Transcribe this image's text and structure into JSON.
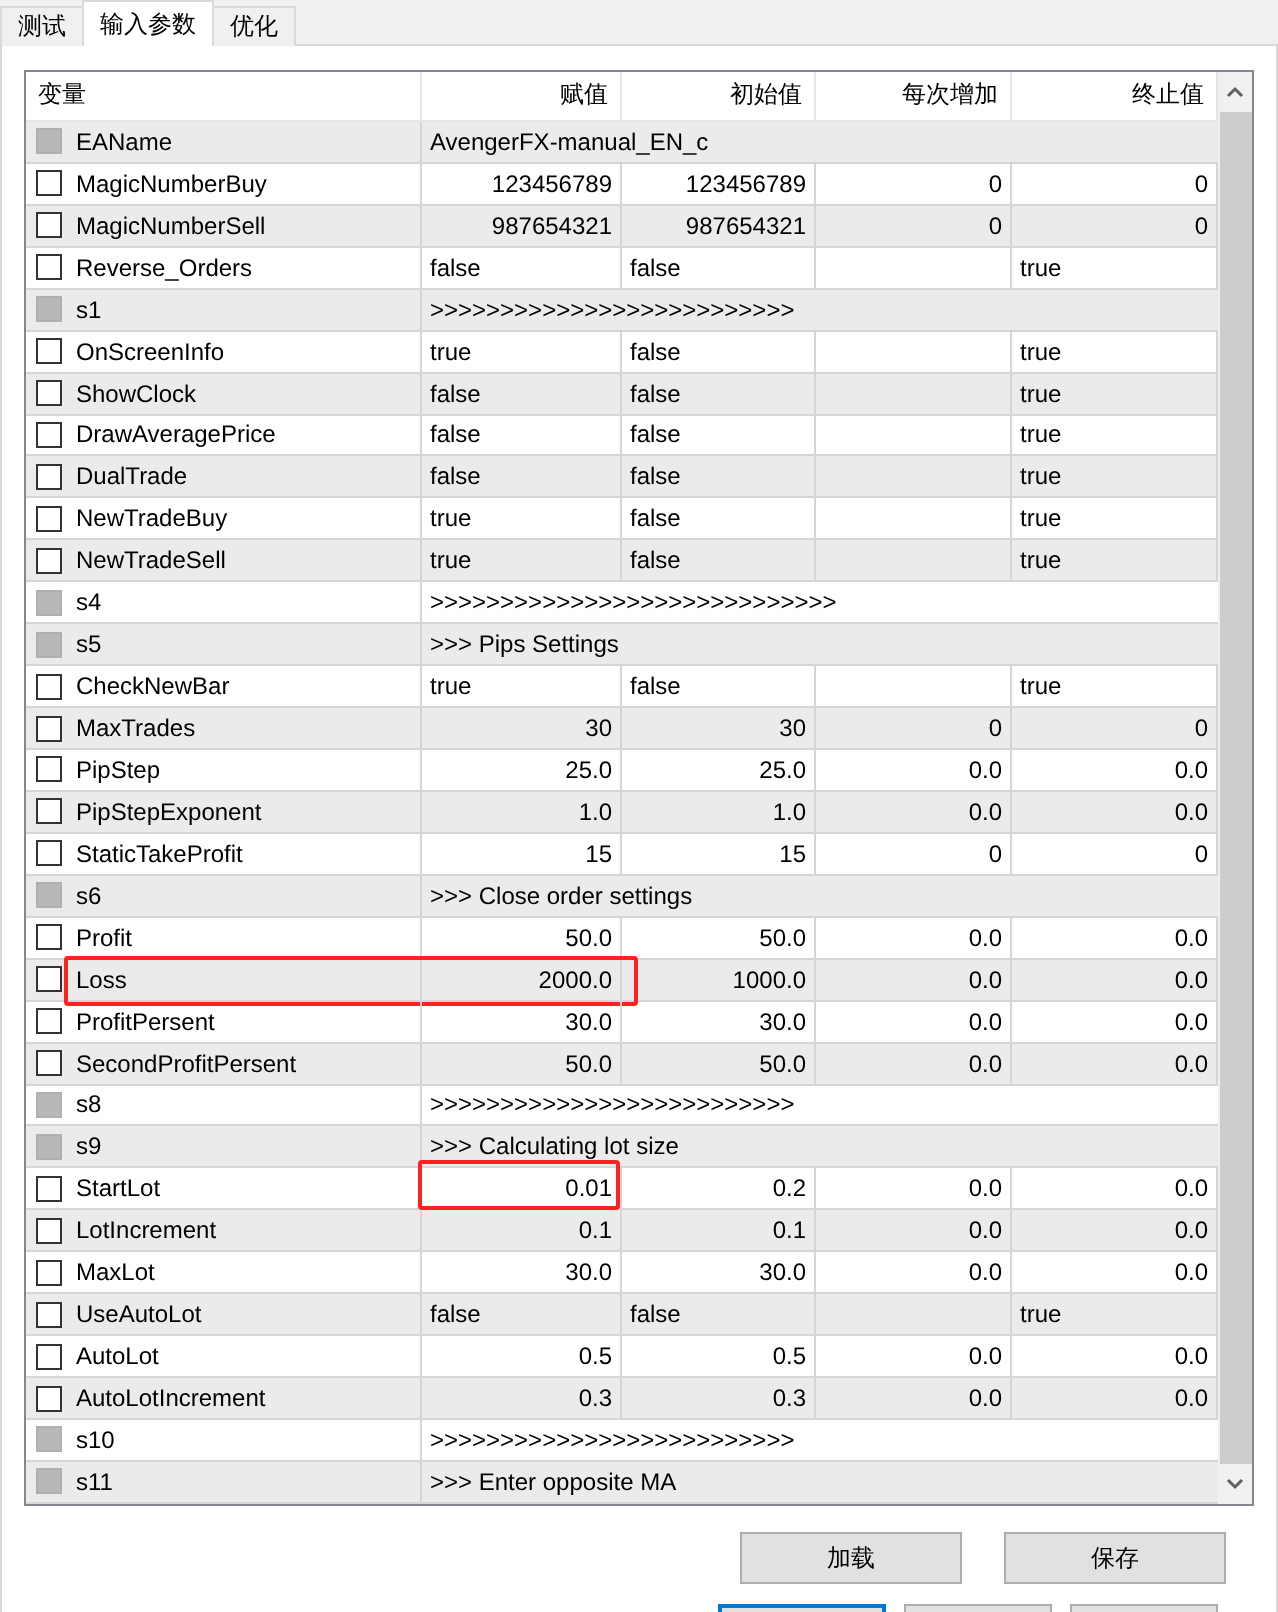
{
  "tabs": [
    {
      "label": "测试",
      "selected": false
    },
    {
      "label": "输入参数",
      "selected": true
    },
    {
      "label": "优化",
      "selected": false
    }
  ],
  "table": {
    "columns": [
      "变量",
      "赋值",
      "初始值",
      "每次增加",
      "终止值"
    ],
    "rows": [
      {
        "kind": "span",
        "name": "EAName",
        "checked": false,
        "disabled": true,
        "value": "AvengerFX-manual_EN_c"
      },
      {
        "kind": "number",
        "name": "MagicNumberBuy",
        "checked": false,
        "disabled": false,
        "value": "123456789",
        "start": "123456789",
        "step": "0",
        "stop": "0"
      },
      {
        "kind": "number",
        "name": "MagicNumberSell",
        "checked": false,
        "disabled": false,
        "value": "987654321",
        "start": "987654321",
        "step": "0",
        "stop": "0"
      },
      {
        "kind": "bool",
        "name": "Reverse_Orders",
        "checked": false,
        "disabled": false,
        "value": "false",
        "start": "false",
        "stop": "true"
      },
      {
        "kind": "span",
        "name": "s1",
        "checked": false,
        "disabled": true,
        "value": ">>>>>>>>>>>>>>>>>>>>>>>>>>"
      },
      {
        "kind": "bool",
        "name": "OnScreenInfo",
        "checked": false,
        "disabled": false,
        "value": "true",
        "start": "false",
        "stop": "true"
      },
      {
        "kind": "bool",
        "name": "ShowClock",
        "checked": false,
        "disabled": false,
        "value": "false",
        "start": "false",
        "stop": "true"
      },
      {
        "kind": "bool",
        "name": "DrawAveragePrice",
        "checked": false,
        "disabled": false,
        "value": "false",
        "start": "false",
        "stop": "true"
      },
      {
        "kind": "bool",
        "name": "DualTrade",
        "checked": false,
        "disabled": false,
        "value": "false",
        "start": "false",
        "stop": "true"
      },
      {
        "kind": "bool",
        "name": "NewTradeBuy",
        "checked": false,
        "disabled": false,
        "value": "true",
        "start": "false",
        "stop": "true"
      },
      {
        "kind": "bool",
        "name": "NewTradeSell",
        "checked": false,
        "disabled": false,
        "value": "true",
        "start": "false",
        "stop": "true"
      },
      {
        "kind": "span",
        "name": "s4",
        "checked": false,
        "disabled": true,
        "value": ">>>>>>>>>>>>>>>>>>>>>>>>>>>>>"
      },
      {
        "kind": "span",
        "name": "s5",
        "checked": false,
        "disabled": true,
        "value": ">>> Pips Settings"
      },
      {
        "kind": "bool",
        "name": "CheckNewBar",
        "checked": false,
        "disabled": false,
        "value": "true",
        "start": "false",
        "stop": "true"
      },
      {
        "kind": "number",
        "name": "MaxTrades",
        "checked": false,
        "disabled": false,
        "value": "30",
        "start": "30",
        "step": "0",
        "stop": "0"
      },
      {
        "kind": "number",
        "name": "PipStep",
        "checked": false,
        "disabled": false,
        "value": "25.0",
        "start": "25.0",
        "step": "0.0",
        "stop": "0.0"
      },
      {
        "kind": "number",
        "name": "PipStepExponent",
        "checked": false,
        "disabled": false,
        "value": "1.0",
        "start": "1.0",
        "step": "0.0",
        "stop": "0.0"
      },
      {
        "kind": "number",
        "name": "StaticTakeProfit",
        "checked": false,
        "disabled": false,
        "value": "15",
        "start": "15",
        "step": "0",
        "stop": "0"
      },
      {
        "kind": "span",
        "name": "s6",
        "checked": false,
        "disabled": true,
        "value": ">>> Close order settings"
      },
      {
        "kind": "number",
        "name": "Profit",
        "checked": false,
        "disabled": false,
        "value": "50.0",
        "start": "50.0",
        "step": "0.0",
        "stop": "0.0"
      },
      {
        "kind": "number",
        "name": "Loss",
        "checked": false,
        "disabled": false,
        "value": "2000.0",
        "start": "1000.0",
        "step": "0.0",
        "stop": "0.0",
        "name_highlighted": true,
        "value_highlighted": true
      },
      {
        "kind": "number",
        "name": "ProfitPersent",
        "checked": false,
        "disabled": false,
        "value": "30.0",
        "start": "30.0",
        "step": "0.0",
        "stop": "0.0"
      },
      {
        "kind": "number",
        "name": "SecondProfitPersent",
        "checked": false,
        "disabled": false,
        "value": "50.0",
        "start": "50.0",
        "step": "0.0",
        "stop": "0.0"
      },
      {
        "kind": "span",
        "name": "s8",
        "checked": false,
        "disabled": true,
        "value": ">>>>>>>>>>>>>>>>>>>>>>>>>>"
      },
      {
        "kind": "span",
        "name": "s9",
        "checked": false,
        "disabled": true,
        "value": ">>> Calculating lot size"
      },
      {
        "kind": "number",
        "name": "StartLot",
        "checked": false,
        "disabled": false,
        "value": "0.01",
        "start": "0.2",
        "step": "0.0",
        "stop": "0.0",
        "name_highlighted": false,
        "value_highlighted": true
      },
      {
        "kind": "number",
        "name": "LotIncrement",
        "checked": false,
        "disabled": false,
        "value": "0.1",
        "start": "0.1",
        "step": "0.0",
        "stop": "0.0"
      },
      {
        "kind": "number",
        "name": "MaxLot",
        "checked": false,
        "disabled": false,
        "value": "30.0",
        "start": "30.0",
        "step": "0.0",
        "stop": "0.0"
      },
      {
        "kind": "bool",
        "name": "UseAutoLot",
        "checked": false,
        "disabled": false,
        "value": "false",
        "start": "false",
        "stop": "true"
      },
      {
        "kind": "number",
        "name": "AutoLot",
        "checked": false,
        "disabled": false,
        "value": "0.5",
        "start": "0.5",
        "step": "0.0",
        "stop": "0.0"
      },
      {
        "kind": "number",
        "name": "AutoLotIncrement",
        "checked": false,
        "disabled": false,
        "value": "0.3",
        "start": "0.3",
        "step": "0.0",
        "stop": "0.0"
      },
      {
        "kind": "span",
        "name": "s10",
        "checked": false,
        "disabled": true,
        "value": ">>>>>>>>>>>>>>>>>>>>>>>>>>"
      },
      {
        "kind": "span",
        "name": "s11",
        "checked": false,
        "disabled": true,
        "value": ">>> Enter opposite MA"
      }
    ]
  },
  "buttons": [
    "加载",
    "保存"
  ]
}
